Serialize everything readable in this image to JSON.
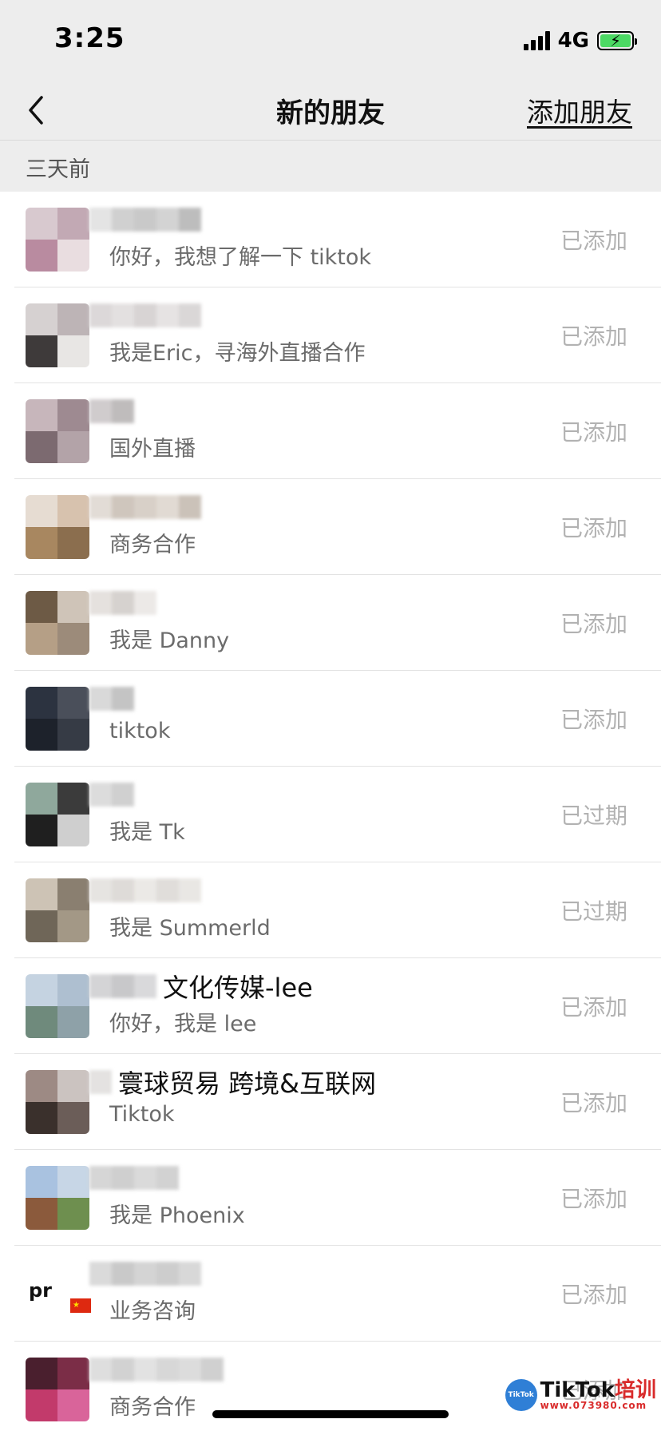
{
  "status_bar": {
    "time": "3:25",
    "network": "4G"
  },
  "nav": {
    "title": "新的朋友",
    "action": "添加朋友"
  },
  "section": {
    "label": "三天前"
  },
  "items": [
    {
      "name": "",
      "message": "你好，我想了解一下 tiktok",
      "status": "已添加"
    },
    {
      "name": "",
      "message": "我是Eric，寻海外直播合作",
      "status": "已添加"
    },
    {
      "name": "",
      "message": "国外直播",
      "status": "已添加"
    },
    {
      "name": "",
      "message": "商务合作",
      "status": "已添加"
    },
    {
      "name": "",
      "message": "我是 Danny",
      "status": "已添加"
    },
    {
      "name": "",
      "message": "tiktok",
      "status": "已添加"
    },
    {
      "name": "",
      "message": "我是 Tk",
      "status": "已过期"
    },
    {
      "name": "",
      "message": "我是 Summerld",
      "status": "已过期"
    },
    {
      "name": "文化传媒-lee",
      "message": "你好，我是 lee",
      "status": "已添加"
    },
    {
      "name": "寰球贸易 跨境&互联网",
      "message": "Tiktok",
      "status": "已添加"
    },
    {
      "name": "",
      "message": "我是 Phoenix",
      "status": "已添加"
    },
    {
      "name": "",
      "message": "业务咨询",
      "status": "已添加"
    },
    {
      "name": "",
      "message": "商务合作",
      "status": "已添加"
    }
  ],
  "colors": {
    "header_bg": "#ededed",
    "status_added": "#b2b2b2",
    "battery": "#4cd964"
  },
  "watermark": {
    "brand_prefix": "TikTok",
    "brand_suffix": "培训",
    "url": "www.073980.com",
    "logo_text": "TikTok"
  }
}
